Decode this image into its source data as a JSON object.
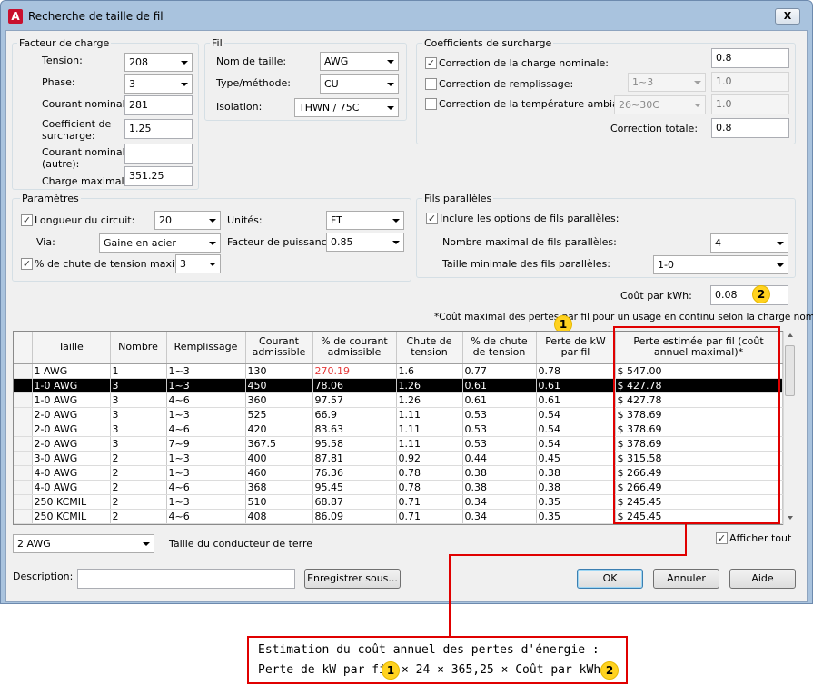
{
  "window": {
    "title": "Recherche de taille de fil",
    "close_glyph": "X",
    "app_icon": "autocad-icon"
  },
  "facteur_charge": {
    "title": "Facteur de charge",
    "tension_label": "Tension:",
    "tension_value": "208",
    "phase_label": "Phase:",
    "phase_value": "3",
    "courant_nominal_label": "Courant nominal:",
    "courant_nominal_value": "281",
    "coef_label_1": "Coefficient de",
    "coef_label_2": "surcharge:",
    "coef_value": "1.25",
    "courant_autre_label_1": "Courant nominal",
    "courant_autre_label_2": "(autre):",
    "courant_autre_value": "",
    "charge_max_label": "Charge maximale:",
    "charge_max_value": "351.25"
  },
  "fil": {
    "title": "Fil",
    "nom_taille_label": "Nom de taille:",
    "nom_taille_value": "AWG",
    "type_label": "Type/méthode:",
    "type_value": "CU",
    "isolation_label": "Isolation:",
    "isolation_value": "THWN / 75C"
  },
  "coefficients": {
    "title": "Coefficients de surcharge",
    "charge_nominale_label": "Correction de la charge nominale:",
    "charge_nominale_checked": true,
    "charge_nominale_value": "0.8",
    "remplissage_label": "Correction de remplissage:",
    "remplissage_combo": "1~3",
    "remplissage_value": "1.0",
    "temperature_label": "Correction de la température ambiante:",
    "temperature_combo": "26~30C",
    "temperature_value": "1.0",
    "totale_label": "Correction totale:",
    "totale_value": "0.8"
  },
  "parametres": {
    "title": "Paramètres",
    "longueur_label": "Longueur du circuit:",
    "longueur_value": "20",
    "unites_label": "Unités:",
    "unites_value": "FT",
    "via_label": "Via:",
    "via_value": "Gaine en acier",
    "facteur_label": "Facteur de puissance:",
    "facteur_value": "0.85",
    "chute_label": "% de chute de tension maximal:",
    "chute_value": "3"
  },
  "fils_paralleles": {
    "title": "Fils parallèles",
    "inclure_label": "Inclure les options de fils parallèles:",
    "nombre_max_label": "Nombre maximal de fils parallèles:",
    "nombre_max_value": "4",
    "taille_min_label": "Taille minimale des fils parallèles:",
    "taille_min_value": "1-0"
  },
  "cout": {
    "label": "Coût par kWh:",
    "value": "0.08"
  },
  "note": "*Coût maximal des pertes par fil pour un usage en continu selon la charge nominale",
  "table": {
    "headers": [
      "Taille",
      "Nombre",
      "Remplissage",
      "Courant admissible",
      "% de courant admissible",
      "Chute de tension",
      "% de chute de tension",
      "Perte de kW par fil",
      "Perte estimée par fil (coût annuel maximal)*"
    ],
    "rows": [
      [
        "1 AWG",
        "1",
        "1~3",
        "130",
        "270.19",
        "1.6",
        "0.77",
        "0.78",
        "$ 547.00"
      ],
      [
        "1-0 AWG",
        "3",
        "1~3",
        "450",
        "78.06",
        "1.26",
        "0.61",
        "0.61",
        "$ 427.78"
      ],
      [
        "1-0 AWG",
        "3",
        "4~6",
        "360",
        "97.57",
        "1.26",
        "0.61",
        "0.61",
        "$ 427.78"
      ],
      [
        "2-0 AWG",
        "3",
        "1~3",
        "525",
        "66.9",
        "1.11",
        "0.53",
        "0.54",
        "$ 378.69"
      ],
      [
        "2-0 AWG",
        "3",
        "4~6",
        "420",
        "83.63",
        "1.11",
        "0.53",
        "0.54",
        "$ 378.69"
      ],
      [
        "2-0 AWG",
        "3",
        "7~9",
        "367.5",
        "95.58",
        "1.11",
        "0.53",
        "0.54",
        "$ 378.69"
      ],
      [
        "3-0 AWG",
        "2",
        "1~3",
        "400",
        "87.81",
        "0.92",
        "0.44",
        "0.45",
        "$ 315.58"
      ],
      [
        "4-0 AWG",
        "2",
        "1~3",
        "460",
        "76.36",
        "0.78",
        "0.38",
        "0.38",
        "$ 266.49"
      ],
      [
        "4-0 AWG",
        "2",
        "4~6",
        "368",
        "95.45",
        "0.78",
        "0.38",
        "0.38",
        "$ 266.49"
      ],
      [
        "250 KCMIL",
        "2",
        "1~3",
        "510",
        "68.87",
        "0.71",
        "0.34",
        "0.35",
        "$ 245.45"
      ],
      [
        "250 KCMIL",
        "2",
        "4~6",
        "408",
        "86.09",
        "0.71",
        "0.34",
        "0.35",
        "$ 245.45"
      ]
    ],
    "selected_row": 1,
    "warning_color": "#e53b3b"
  },
  "ground": {
    "value": "2 AWG",
    "label": "Taille du conducteur de terre"
  },
  "afficher_tout": "Afficher tout",
  "description": {
    "label": "Description:",
    "value": ""
  },
  "buttons": {
    "save_as": "Enregistrer sous...",
    "ok": "OK",
    "cancel": "Annuler",
    "help": "Aide"
  },
  "callouts": {
    "one": "1",
    "two": "2"
  },
  "annotation": {
    "line1": "Estimation du coût annuel des pertes d'énergie :",
    "line2_a": "Perte de kW par fil",
    "line2_b": "× 24 × 365,25 × Coût par kWh",
    "accent_color": "#e00000",
    "badge_color": "#ffd21f"
  }
}
